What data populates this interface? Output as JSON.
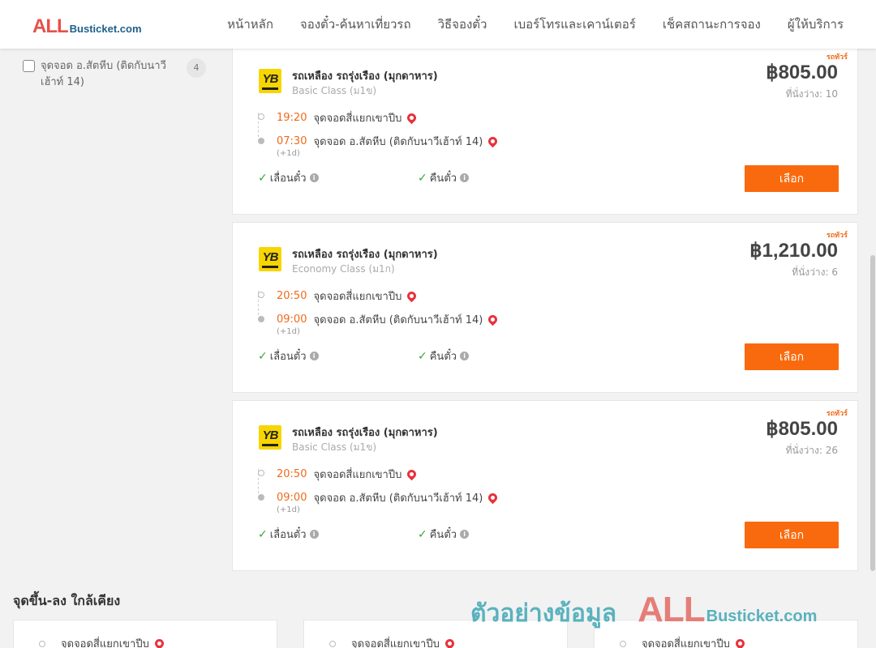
{
  "header": {
    "logo_all": "ALL",
    "logo_busticket": "Busticket.com",
    "nav": [
      "หน้าหลัก",
      "จองตั๋ว-ค้นหาเที่ยวรถ",
      "วิธีจองตั๋ว",
      "เบอร์โทรและเคาน์เตอร์",
      "เช็คสถานะการจอง",
      "ผู้ให้บริการ"
    ]
  },
  "sidebar": {
    "filter": {
      "label": "จุดจอด อ.สัตหีบ (ติดกับนาวีเฮ้าท์ 14)",
      "count": "4",
      "checked": false
    }
  },
  "trips": [
    {
      "ribbon": "รถทัวร์",
      "operator": "รถเหลือง รถรุ่งเรือง (มุกดาหาร)",
      "class": "Basic Class (ม1ข)",
      "price": "฿805.00",
      "seats": "ที่นั่งว่าง: 10",
      "depart_time": "19:20",
      "depart_place": "จุดจอดสี่แยกเขาปีบ",
      "arrive_time": "07:30",
      "arrive_place": "จุดจอด อ.สัตหีบ (ติดกับนาวีเฮ้าท์ 14)",
      "plus_day": "(+1d)",
      "change_label": "เลื่อนตั๋ว",
      "refund_label": "คืนตั๋ว",
      "select_label": "เลือก"
    },
    {
      "ribbon": "รถทัวร์",
      "operator": "รถเหลือง รถรุ่งเรือง (มุกดาหาร)",
      "class": "Economy Class (ม1ก)",
      "price": "฿1,210.00",
      "seats": "ที่นั่งว่าง: 6",
      "depart_time": "20:50",
      "depart_place": "จุดจอดสี่แยกเขาปีบ",
      "arrive_time": "09:00",
      "arrive_place": "จุดจอด อ.สัตหีบ (ติดกับนาวีเฮ้าท์ 14)",
      "plus_day": "(+1d)",
      "change_label": "เลื่อนตั๋ว",
      "refund_label": "คืนตั๋ว",
      "select_label": "เลือก"
    },
    {
      "ribbon": "รถทัวร์",
      "operator": "รถเหลือง รถรุ่งเรือง (มุกดาหาร)",
      "class": "Basic Class (ม1ข)",
      "price": "฿805.00",
      "seats": "ที่นั่งว่าง: 26",
      "depart_time": "20:50",
      "depart_place": "จุดจอดสี่แยกเขาปีบ",
      "arrive_time": "09:00",
      "arrive_place": "จุดจอด อ.สัตหีบ (ติดกับนาวีเฮ้าท์ 14)",
      "plus_day": "(+1d)",
      "change_label": "เลื่อนตั๋ว",
      "refund_label": "คืนตั๋ว",
      "select_label": "เลือก"
    }
  ],
  "nearby": {
    "title": "จุดขึ้น-ลง ใกล้เคียง",
    "items": [
      "จุดจอดสี่แยกเขาปีบ",
      "จุดจอดสี่แยกเขาปีบ",
      "จุดจอดสี่แยกเขาปีบ"
    ]
  },
  "watermark": {
    "thai": "ตัวอย่างข้อมูล",
    "all": "ALL",
    "busticket": "Busticket.com"
  },
  "colors": {
    "accent": "#f96a0e",
    "time": "#f06a1a",
    "logo_red": "#e8504a",
    "logo_blue": "#1d5f8c",
    "check": "#3aa53a",
    "pin": "#e8323c",
    "operator_yellow": "#f7d500"
  },
  "icons": {
    "pin": "map-pin-icon",
    "check": "checkmark-icon",
    "info": "info-icon",
    "operator": "yellow-bus-logo-icon"
  }
}
